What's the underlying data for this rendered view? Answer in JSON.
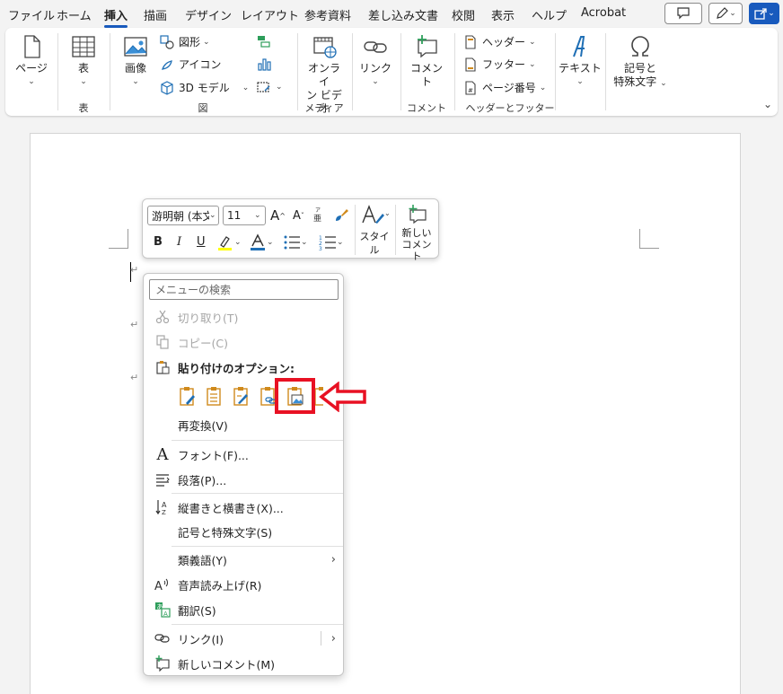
{
  "tabs": [
    "ファイル",
    "ホーム",
    "挿入",
    "描画",
    "デザイン",
    "レイアウト",
    "参考資料",
    "差し込み文書",
    "校閲",
    "表示",
    "ヘルプ",
    "Acrobat"
  ],
  "active_tab": "挿入",
  "ribbon": {
    "page": "ページ",
    "table": "表",
    "image": "画像",
    "shapes": "図形",
    "icons": "アイコン",
    "model3d": "3D モデル",
    "online_video_l1": "オンライ",
    "online_video_l2": "ン ビデオ",
    "link": "リンク",
    "comment": "コメント",
    "header": "ヘッダー",
    "footer": "フッター",
    "page_number": "ページ番号",
    "text": "テキスト",
    "symbols_l1": "記号と",
    "symbols_l2": "特殊文字",
    "groups": {
      "table": "表",
      "illustrations": "図",
      "media": "メディア",
      "comment": "コメント",
      "header_footer": "ヘッダーとフッター"
    }
  },
  "mini_toolbar": {
    "font": "游明朝 (本文",
    "size": "11",
    "grow": "A",
    "shrink": "A",
    "bold": "B",
    "italic": "I",
    "underline": "U",
    "style": "スタイル",
    "new_comment_l1": "新しい",
    "new_comment_l2": "コメント"
  },
  "context_menu": {
    "search_placeholder": "メニューの検索",
    "cut": "切り取り(T)",
    "copy": "コピー(C)",
    "paste_options": "貼り付けのオプション:",
    "reconvert": "再変換(V)",
    "font": "フォント(F)...",
    "paragraph": "段落(P)...",
    "vertical_horizontal": "縦書きと横書き(X)...",
    "symbols": "記号と特殊文字(S)",
    "synonyms": "類義語(Y)",
    "read_aloud": "音声読み上げ(R)",
    "translate": "翻訳(S)",
    "link": "リンク(I)",
    "new_comment": "新しいコメント(M)"
  },
  "colors": {
    "accent": "#185abd",
    "highlight_annotation": "#e81123",
    "paste_icon": "#d08a1c"
  }
}
